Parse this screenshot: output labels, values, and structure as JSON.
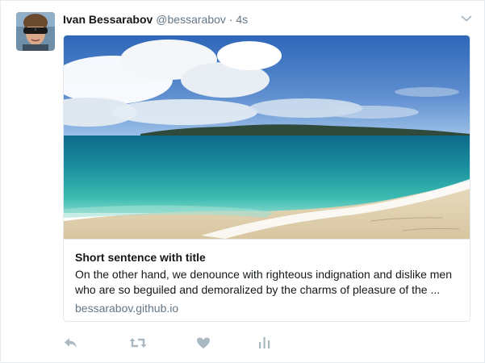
{
  "tweet": {
    "author_name": "Ivan Bessarabov",
    "author_handle": "@bessarabov",
    "separator": "·",
    "timestamp": "4s",
    "avatar_icon": "avatar-photo",
    "menu_icon": "chevron-down-icon"
  },
  "card": {
    "image": "beach-photo",
    "title": "Short sentence with title",
    "description": "On the other hand, we denounce with righteous indignation and dislike men who are so beguiled and demoralized by the charms of pleasure of the ...",
    "domain": "bessarabov.github.io"
  },
  "actions": {
    "reply_icon": "reply-icon",
    "retweet_icon": "retweet-icon",
    "like_icon": "heart-icon",
    "analytics_icon": "analytics-icon",
    "icon_color": "#aab8c2"
  }
}
